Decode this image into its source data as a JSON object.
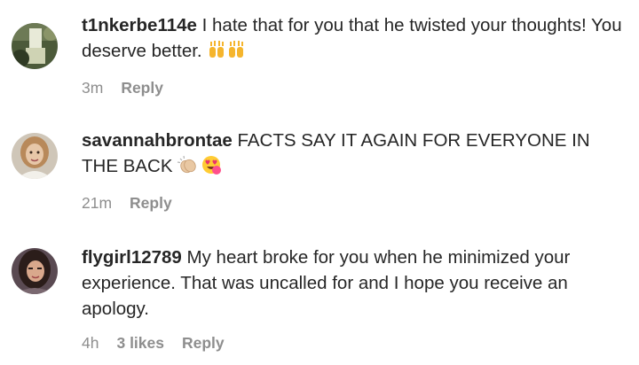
{
  "comments": [
    {
      "username": "t1nkerbe114e",
      "text": "I hate that for you that he twisted your thoughts! You deserve better.",
      "emoji": "raising-hands-emoji",
      "time": "3m",
      "likes": "",
      "reply_label": "Reply"
    },
    {
      "username": "savannahbrontae",
      "text": "FACTS SAY IT AGAIN FOR EVERYONE IN THE BACK",
      "emoji": "clapping-hands-and-heart-eyes-emoji",
      "time": "21m",
      "likes": "",
      "reply_label": "Reply"
    },
    {
      "username": "flygirl12789",
      "text": "My heart broke for you when he minimized your experience. That was uncalled for and I hope you receive an apology.",
      "time": "4h",
      "likes": "3 likes",
      "reply_label": "Reply"
    }
  ]
}
